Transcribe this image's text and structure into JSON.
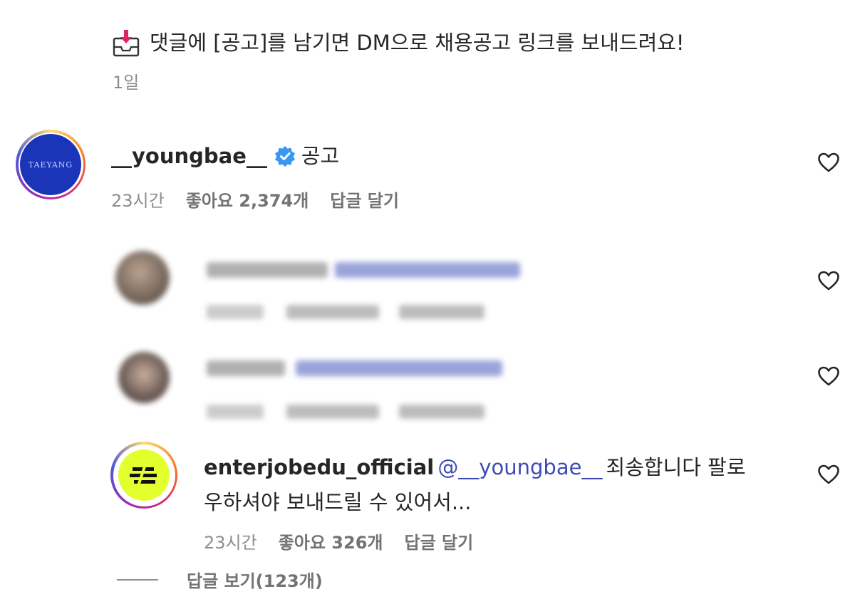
{
  "caption": {
    "icon": "inbox-download-icon",
    "text": "댓글에 [공고]를 남기면 DM으로 채용공고 링크를 보내드려요!",
    "time": "1일"
  },
  "comments": [
    {
      "username": "__youngbae__",
      "verified": true,
      "text": "공고",
      "avatar_text": "TAEYANG",
      "time": "23시간",
      "likes": "좋아요 2,374개",
      "reply": "답글 달기"
    },
    {
      "username": "enterjobedu_official",
      "mention": "@__youngbae__",
      "text_line1": "죄송합니다 팔로",
      "text_line2": "우하셔야 보내드릴 수 있어서...",
      "time": "23시간",
      "likes": "좋아요 326개",
      "reply": "답글 달기"
    }
  ],
  "view_replies": "답글 보기(123개)",
  "colors": {
    "verified": "#3897f0",
    "mention": "#3d4bb5",
    "muted": "#8e8e8e",
    "ej_logo_bg": "#e4ff2e",
    "taeyang_avatar_bg": "#1a35b8"
  }
}
